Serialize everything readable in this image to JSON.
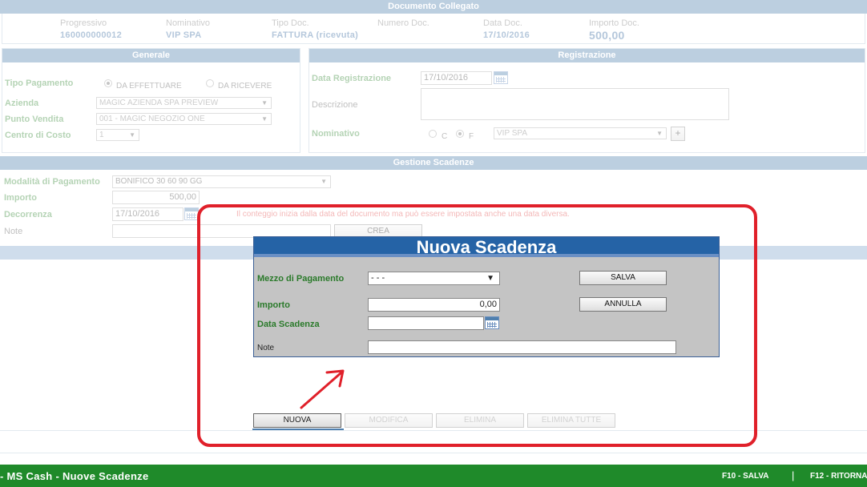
{
  "document": {
    "title": "Documento Collegato",
    "progressivo_label": "Progressivo",
    "progressivo": "160000000012",
    "nominativo_label": "Nominativo",
    "nominativo": "VIP SPA",
    "tipo_doc_label": "Tipo Doc.",
    "tipo_doc": "FATTURA (ricevuta)",
    "numero_doc_label": "Numero Doc.",
    "numero_doc": "",
    "data_doc_label": "Data Doc.",
    "data_doc": "17/10/2016",
    "importo_doc_label": "Importo Doc.",
    "importo_doc": "500,00"
  },
  "generale": {
    "title": "Generale",
    "tipo_pagamento_label": "Tipo Pagamento",
    "radio_effettuare": "DA EFFETTUARE",
    "radio_ricevere": "DA RICEVERE",
    "azienda_label": "Azienda",
    "azienda": "MAGIC AZIENDA SPA PREVIEW",
    "punto_vendita_label": "Punto Vendita",
    "punto_vendita": "001 - MAGIC NEGOZIO ONE",
    "centro_costo_label": "Centro di Costo",
    "centro_costo": "1"
  },
  "registrazione": {
    "title": "Registrazione",
    "data_label": "Data Registrazione",
    "data": "17/10/2016",
    "descrizione_label": "Descrizione",
    "descrizione": "",
    "nominativo_label": "Nominativo",
    "radio_c": "C",
    "radio_f": "F",
    "nominativo": "VIP SPA",
    "add_label": "+"
  },
  "gestione": {
    "title": "Gestione Scadenze",
    "modalita_label": "Modalità di Pagamento",
    "modalita": "BONIFICO 30 60 90 GG",
    "importo_label": "Importo",
    "importo": "500,00",
    "decorrenza_label": "Decorrenza",
    "decorrenza": "17/10/2016",
    "note_label": "Note",
    "note": "",
    "hint": "Il conteggio inizia dalla data del documento ma può essere impostata anche una data diversa.",
    "crea_label": "CREA"
  },
  "modal": {
    "title": "Nuova Scadenza",
    "mezzo_label": "Mezzo di Pagamento",
    "mezzo": "- - -",
    "importo_label": "Importo",
    "importo": "0,00",
    "data_scadenza_label": "Data Scadenza",
    "data_scadenza": "",
    "note_label": "Note",
    "note": "",
    "salva_label": "SALVA",
    "annulla_label": "ANNULLA"
  },
  "actions": {
    "nuova": "NUOVA",
    "modifica": "MODIFICA",
    "elimina": "ELIMINA",
    "elimina_tutte": "ELIMINA TUTTE"
  },
  "footer": {
    "app_title": "- MS Cash - Nuove Scadenze",
    "f10": "F10 - SALVA",
    "separator": "|",
    "f12": "F12 - RITORNA"
  },
  "colors": {
    "header_bar": "#4f7fae",
    "footer": "#1f8a2a",
    "highlight": "#e0202a",
    "modal_title": "#2563a6"
  }
}
